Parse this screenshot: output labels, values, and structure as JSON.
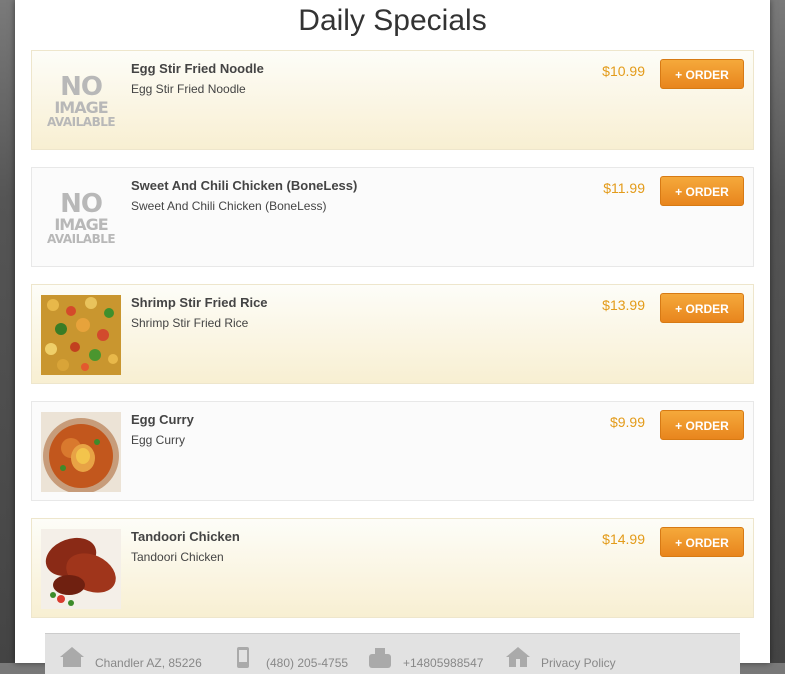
{
  "page": {
    "title": "Daily Specials"
  },
  "items": [
    {
      "name": "Egg Stir Fried Noodle",
      "desc": "Egg Stir Fried Noodle",
      "price": "$10.99",
      "order": "+ ORDER",
      "image": "no-image"
    },
    {
      "name": "Sweet And Chili Chicken (BoneLess)",
      "desc": "Sweet And Chili Chicken (BoneLess)",
      "price": "$11.99",
      "order": "+ ORDER",
      "image": "no-image"
    },
    {
      "name": "Shrimp Stir Fried Rice",
      "desc": "Shrimp Stir Fried Rice",
      "price": "$13.99",
      "order": "+ ORDER",
      "image": "fried-rice-photo"
    },
    {
      "name": "Egg Curry",
      "desc": "Egg Curry",
      "price": "$9.99",
      "order": "+ ORDER",
      "image": "curry-photo"
    },
    {
      "name": "Tandoori Chicken",
      "desc": "Tandoori Chicken",
      "price": "$14.99",
      "order": "+ ORDER",
      "image": "tandoori-photo"
    }
  ],
  "noimage": {
    "line1": "NO",
    "line2": "IMAGE",
    "line3": "AVAILABLE"
  },
  "footer": {
    "address": "Chandler AZ, 85226",
    "phone": "(480) 205-4755",
    "fax": "+14805988547",
    "privacy": "Privacy Policy"
  },
  "colors": {
    "accent": "#e8851d",
    "price": "#e39b1a",
    "tint": "#f8efd2"
  }
}
